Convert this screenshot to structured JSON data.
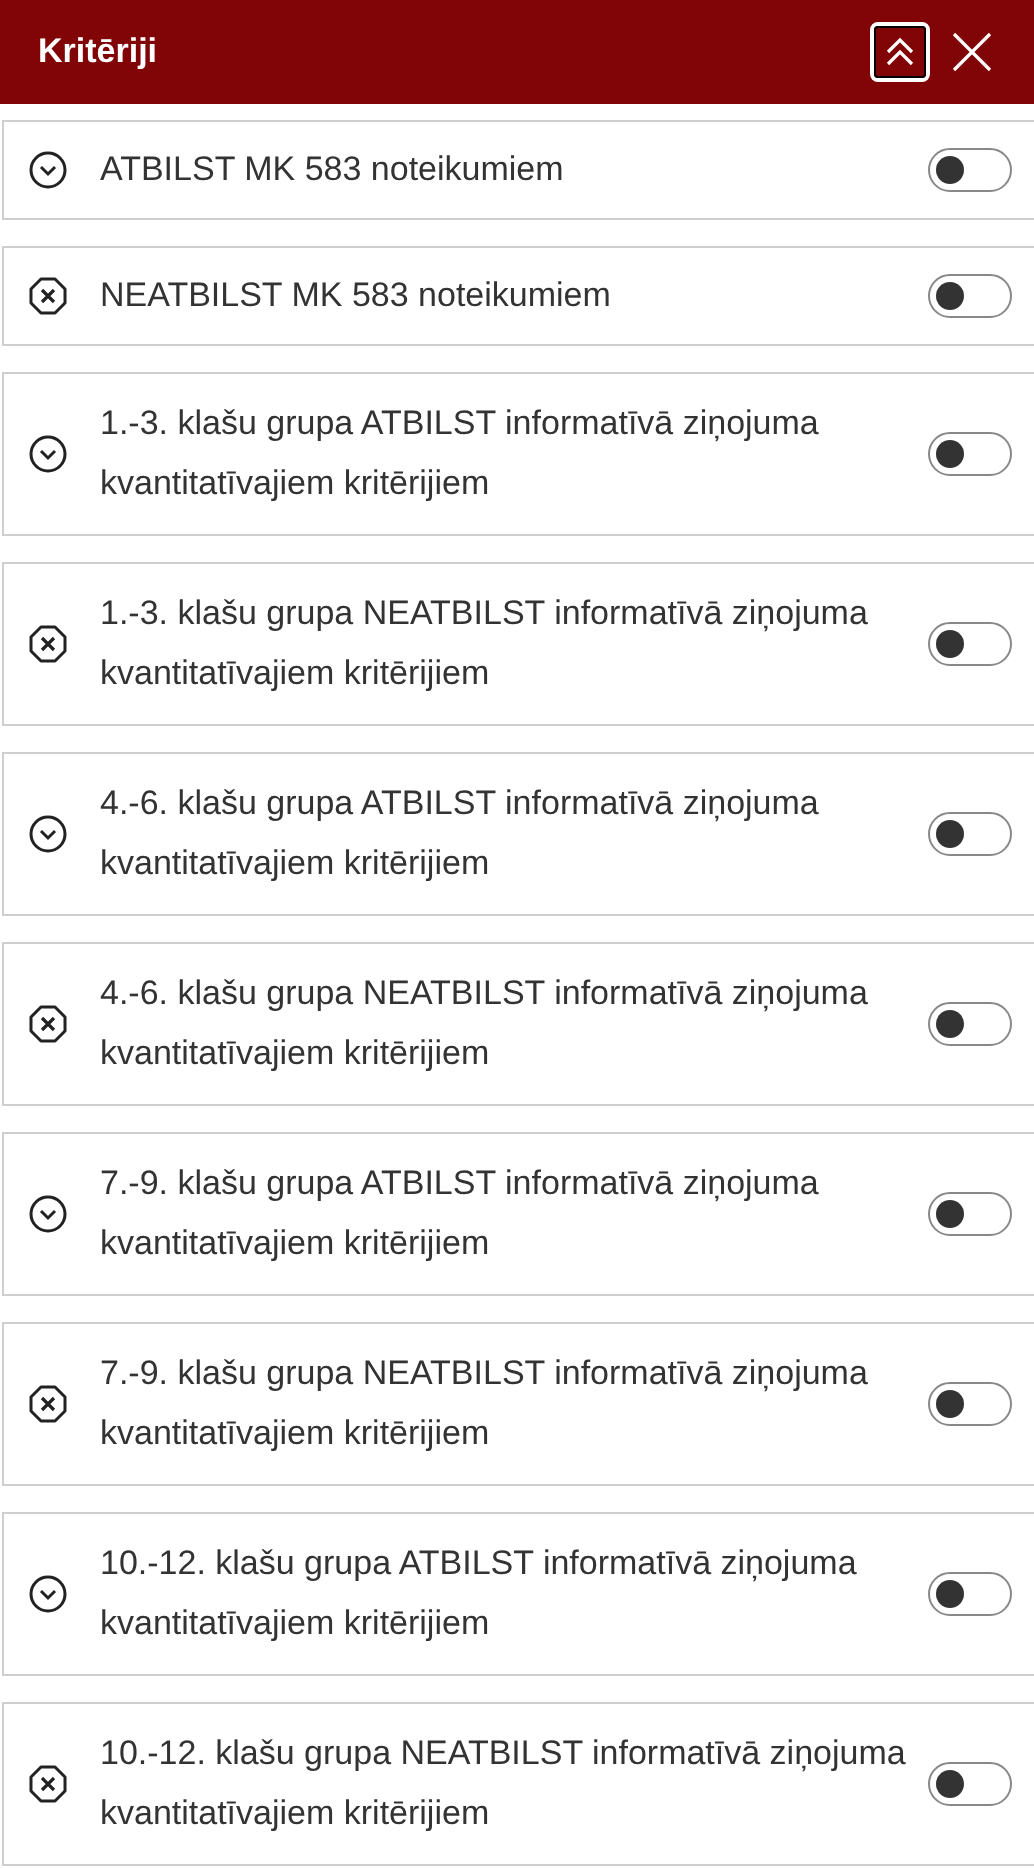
{
  "header": {
    "title": "Kritēriji"
  },
  "criteria": [
    {
      "kind": "match",
      "label": "ATBILST MK 583 noteikumiem",
      "on": false
    },
    {
      "kind": "mismatch",
      "label": "NEATBILST MK 583 noteikumiem",
      "on": false
    },
    {
      "kind": "match",
      "label": "1.-3. klašu grupa ATBILST informatīvā ziņojuma kvantitatīvajiem kritērijiem",
      "on": false
    },
    {
      "kind": "mismatch",
      "label": "1.-3. klašu grupa NEATBILST informatīvā ziņojuma kvantitatīvajiem kritērijiem",
      "on": false
    },
    {
      "kind": "match",
      "label": "4.-6. klašu grupa ATBILST informatīvā ziņojuma kvantitatīvajiem kritērijiem",
      "on": false
    },
    {
      "kind": "mismatch",
      "label": "4.-6. klašu grupa NEATBILST informatīvā ziņojuma kvantitatīvajiem kritērijiem",
      "on": false
    },
    {
      "kind": "match",
      "label": "7.-9. klašu grupa ATBILST informatīvā ziņojuma kvantitatīvajiem kritērijiem",
      "on": false
    },
    {
      "kind": "mismatch",
      "label": "7.-9. klašu grupa NEATBILST informatīvā ziņojuma kvantitatīvajiem kritērijiem",
      "on": false
    },
    {
      "kind": "match",
      "label": "10.-12. klašu grupa ATBILST informatīvā ziņojuma kvantitatīvajiem kritērijiem",
      "on": false
    },
    {
      "kind": "mismatch",
      "label": "10.-12. klašu grupa NEATBILST informatīvā ziņojuma kvantitatīvajiem kritērijiem",
      "on": false
    }
  ]
}
